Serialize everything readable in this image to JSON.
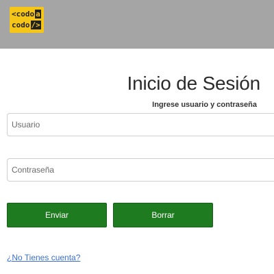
{
  "header": {
    "logo": {
      "line1_prefix": "<codo",
      "line1_accent": "a",
      "line2_prefix": "codo",
      "line2_accent": "/>",
      "colors": {
        "background": "#f5c518",
        "text": "#222222"
      }
    }
  },
  "login": {
    "title": "Inicio de Sesión",
    "subtitle": "Ingrese usuario y contraseña",
    "username_placeholder": "Usuario",
    "username_value": "",
    "password_placeholder": "Contraseña",
    "password_value": "",
    "submit_label": "Enviar",
    "clear_label": "Borrar",
    "signup_link": "¿No Tienes cuenta?"
  },
  "colors": {
    "header_bg": "#a5a5a5",
    "button_bg": "#1e7b20",
    "link": "#3b6fd6"
  }
}
